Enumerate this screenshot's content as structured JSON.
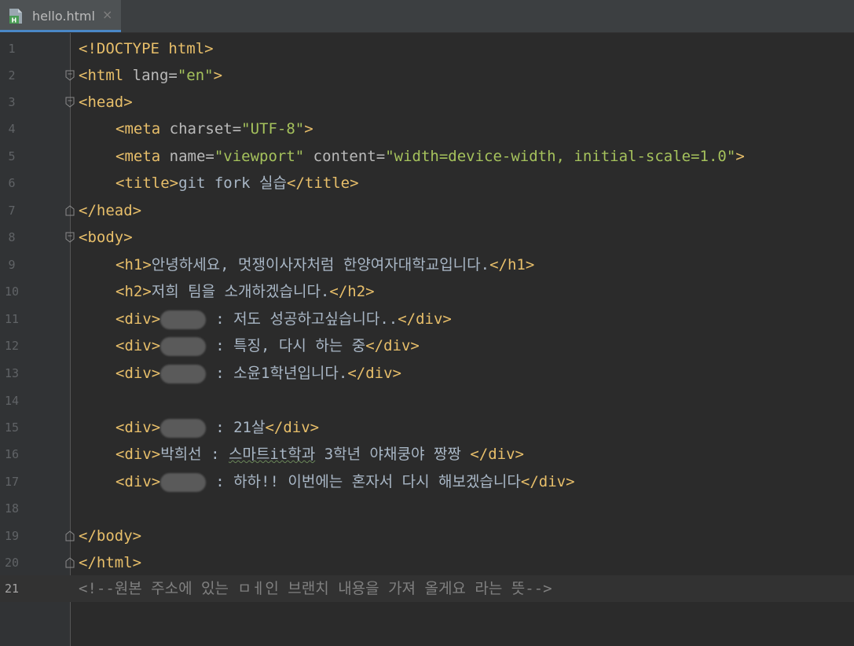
{
  "tab": {
    "filename": "hello.html",
    "close_glyph": "×",
    "icon": "html-file-icon"
  },
  "lines": [
    {
      "n": "1",
      "doctype": "<!DOCTYPE html>"
    },
    {
      "n": "2",
      "tag_open": "<html",
      "attr": " lang=",
      "val": "\"en\"",
      "tag_close": ">"
    },
    {
      "n": "3",
      "tag": "<head>"
    },
    {
      "n": "4",
      "tag_open": "<meta",
      "attr": " charset=",
      "val": "\"UTF-8\"",
      "tag_close": ">"
    },
    {
      "n": "5",
      "tag_open": "<meta",
      "attr1": " name=",
      "val1": "\"viewport\"",
      "attr2": " content=",
      "val2": "\"width=device-width, initial-scale=1.0\"",
      "tag_close": ">"
    },
    {
      "n": "6",
      "open": "<title>",
      "text": "git fork 실습",
      "close": "</title>"
    },
    {
      "n": "7",
      "tag": "</head>"
    },
    {
      "n": "8",
      "tag": "<body>"
    },
    {
      "n": "9",
      "open": "<h1>",
      "text": "안녕하세요, 멋쟁이사자처럼 한양여자대학교입니다.",
      "close": "</h1>"
    },
    {
      "n": "10",
      "open": "<h2>",
      "text": "저희 팀을 소개하겠습니다.",
      "close": "</h2>"
    },
    {
      "n": "11",
      "open": "<div>",
      "text": ": 저도 성공하고싶습니다..",
      "close": "</div>"
    },
    {
      "n": "12",
      "open": "<div>",
      "text": ": 특징, 다시 하는 중",
      "close": "</div>"
    },
    {
      "n": "13",
      "open": "<div>",
      "text": ": 소윤1학년입니다.",
      "close": "</div>"
    },
    {
      "n": "14"
    },
    {
      "n": "15",
      "open": "<div>",
      "text": ": 21살",
      "close": "</div>"
    },
    {
      "n": "16",
      "open": "<div>",
      "name": "박희선",
      "sep": " : ",
      "typo": "스마트it학과",
      "text": " 3학년 야채쿵야 짱짱 ",
      "close": "</div>"
    },
    {
      "n": "17",
      "open": "<div>",
      "text": ": 하하!! 이번에는 혼자서 다시 해보겠습니다",
      "close": "</div>"
    },
    {
      "n": "18"
    },
    {
      "n": "19",
      "tag": "</body>"
    },
    {
      "n": "20",
      "tag": "</html>"
    },
    {
      "n": "21",
      "comment": "<!--원본 주소에 있는 ㅁㅔ인 브랜치 내용을 가져 올게요 라는 뜻-->"
    }
  ],
  "colors": {
    "background": "#2b2b2b",
    "gutter": "#313335",
    "tag": "#e8bf6a",
    "attribute": "#bababa",
    "value": "#a5c25c",
    "text": "#a9b7c6",
    "comment": "#808080"
  }
}
